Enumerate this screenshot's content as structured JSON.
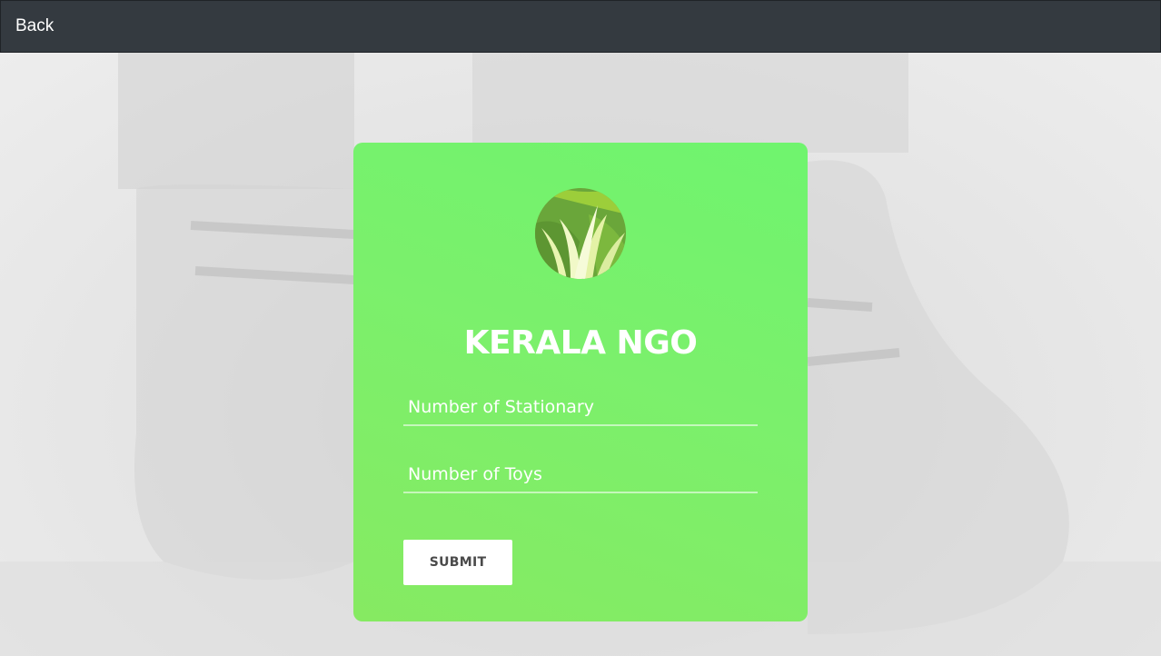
{
  "navbar": {
    "back_label": "Back",
    "background_color": "#343a40"
  },
  "card": {
    "title": "KERALA NGO",
    "logo_icon": "grass-leaf-logo",
    "accent_color": "#77f06c",
    "fields": {
      "stationary": {
        "value": "",
        "placeholder": "Number of Stationary"
      },
      "toys": {
        "value": "",
        "placeholder": "Number of Toys"
      }
    },
    "submit_label": "SUBMIT"
  }
}
